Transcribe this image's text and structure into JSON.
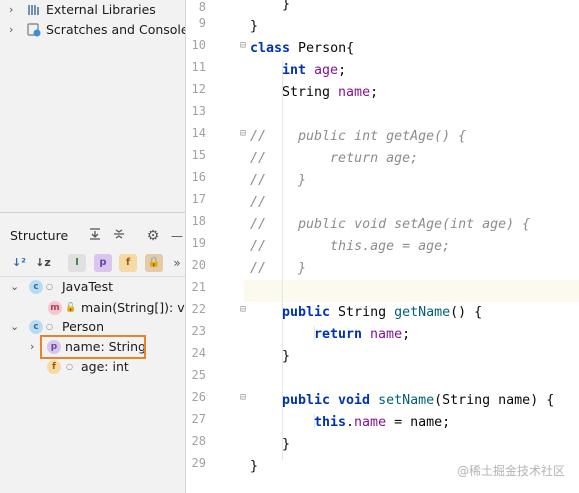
{
  "project": {
    "items": [
      {
        "label": "External Libraries",
        "icon": "library-icon"
      },
      {
        "label": "Scratches and Consoles",
        "icon": "scratches-icon"
      }
    ]
  },
  "structure": {
    "title": "Structure",
    "toolbar": {
      "p_label": "p",
      "f_label": "f",
      "more": "»"
    },
    "tree": [
      {
        "icon": "c",
        "label": "JavaTest"
      },
      {
        "icon": "m",
        "label": "main(String[]): voi"
      },
      {
        "icon": "c",
        "label": "Person"
      },
      {
        "icon": "p",
        "label": "name: String"
      },
      {
        "icon": "f",
        "label": "age: int"
      }
    ]
  },
  "editor": {
    "line_numbers": [
      "8",
      "9",
      "10",
      "11",
      "12",
      "13",
      "14",
      "15",
      "16",
      "17",
      "18",
      "19",
      "20",
      "21",
      "22",
      "23",
      "24",
      "25",
      "26",
      "27",
      "28",
      "29"
    ]
  },
  "code": {
    "l8": "}",
    "l9": "}",
    "l10_kw": "class ",
    "l10_name": "Person{",
    "l11_kw": "int ",
    "l11_fld": "age",
    "l11_end": ";",
    "l12_type": "String ",
    "l12_fld": "name",
    "l12_end": ";",
    "l14": "//    public int getAge() {",
    "l15": "//        return age;",
    "l16": "//    }",
    "l17": "//",
    "l18": "//    public void setAge(int age) {",
    "l19": "//        this.age = age;",
    "l20": "//    }",
    "l22_kw": "public ",
    "l22_type": "String ",
    "l22_fn": "getName",
    "l22_end": "() {",
    "l23_kw": "return ",
    "l23_fld": "name",
    "l23_end": ";",
    "l24": "}",
    "l26_kw": "public void ",
    "l26_fn": "setName",
    "l26_end": "(String name) {",
    "l27_kw": "this",
    "l27_dot": ".",
    "l27_fld": "name",
    "l27_end": " = name;",
    "l28": "}",
    "l29": "}"
  },
  "watermark": "@稀土掘金技术社区"
}
